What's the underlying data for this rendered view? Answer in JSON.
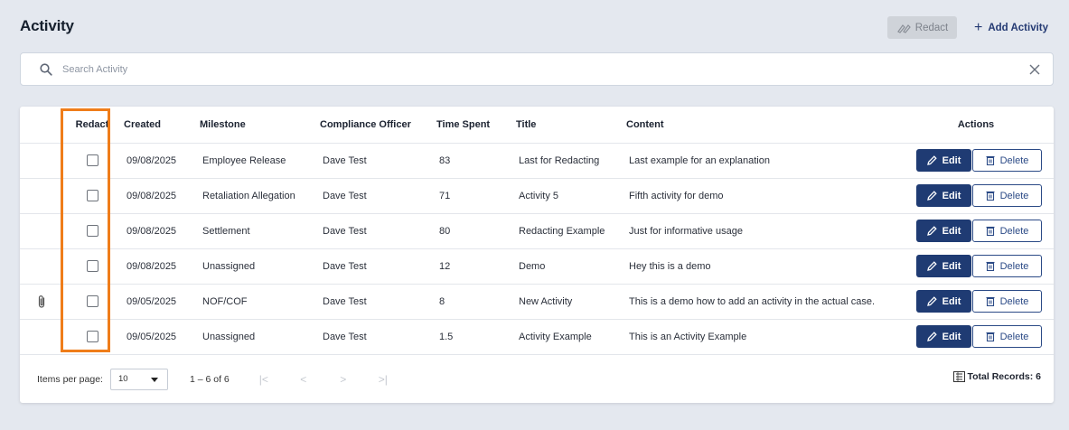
{
  "header": {
    "title": "Activity",
    "redact_label": "Redact",
    "add_label": "Add Activity"
  },
  "search": {
    "placeholder": "Search Activity",
    "value": ""
  },
  "table": {
    "columns": {
      "redact": "Redact",
      "created": "Created",
      "milestone": "Milestone",
      "officer": "Compliance Officer",
      "time": "Time Spent",
      "title": "Title",
      "content": "Content",
      "actions": "Actions"
    },
    "edit_label": "Edit",
    "delete_label": "Delete",
    "rows": [
      {
        "attachment": false,
        "created": "09/08/2025",
        "milestone": "Employee Release",
        "officer": "Dave Test",
        "time": "83",
        "title": "Last for Redacting",
        "content": "Last example for an explanation"
      },
      {
        "attachment": false,
        "created": "09/08/2025",
        "milestone": "Retaliation Allegation",
        "officer": "Dave Test",
        "time": "71",
        "title": "Activity 5",
        "content": "Fifth activity for demo"
      },
      {
        "attachment": false,
        "created": "09/08/2025",
        "milestone": "Settlement",
        "officer": "Dave Test",
        "time": "80",
        "title": "Redacting Example",
        "content": "Just for informative usage"
      },
      {
        "attachment": false,
        "created": "09/08/2025",
        "milestone": "Unassigned",
        "officer": "Dave Test",
        "time": "12",
        "title": "Demo",
        "content": "Hey this is a demo"
      },
      {
        "attachment": true,
        "created": "09/05/2025",
        "milestone": "NOF/COF",
        "officer": "Dave Test",
        "time": "8",
        "title": "New Activity",
        "content": "This is a demo how to add an activity in the actual case."
      },
      {
        "attachment": false,
        "created": "09/05/2025",
        "milestone": "Unassigned",
        "officer": "Dave Test",
        "time": "1.5",
        "title": "Activity Example",
        "content": "This is an Activity Example"
      }
    ]
  },
  "footer": {
    "items_per_page_label": "Items per page:",
    "items_per_page_value": "10",
    "range": "1 – 6 of 6",
    "total_records": "Total Records: 6"
  },
  "colors": {
    "primary": "#1f3b73",
    "highlight": "#ef7d1a",
    "background": "#e4e8ef"
  }
}
